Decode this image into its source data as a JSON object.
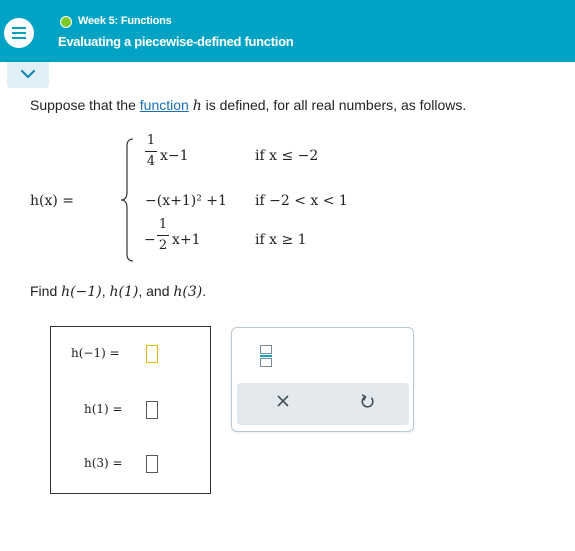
{
  "header": {
    "week_label": "Week 5: Functions",
    "topic_title": "Evaluating a piecewise-defined function",
    "status_color": "#7ccb2b",
    "accent_color": "#00a3c4"
  },
  "prompt": {
    "before_link": "Suppose that the ",
    "link_text": "function",
    "fn_name": "h",
    "after_link": " is defined, for all real numbers, as follows."
  },
  "piecewise": {
    "lhs": "h(x) =",
    "pieces": [
      {
        "frac_num": "1",
        "frac_den": "4",
        "expr": "x−1",
        "cond": "if x ≤ −2"
      },
      {
        "expr": "−(x+1)² +1",
        "cond": "if −2 < x < 1"
      },
      {
        "sign": "−",
        "frac_num": "1",
        "frac_den": "2",
        "expr": "x+1",
        "cond": "if x ≥ 1"
      }
    ]
  },
  "find": {
    "prefix": "Find ",
    "v1": "h(−1)",
    "sep1": ", ",
    "v2": "h(1)",
    "sep2": ", and ",
    "v3": "h(3)",
    "suffix": "."
  },
  "answers": [
    {
      "label": "h(−1) =",
      "value": ""
    },
    {
      "label": "h(1) =",
      "value": ""
    },
    {
      "label": "h(3) =",
      "value": ""
    }
  ],
  "tools": {
    "fraction_icon": "fraction-icon",
    "clear_icon": "x-icon",
    "undo_icon": "undo-icon"
  }
}
